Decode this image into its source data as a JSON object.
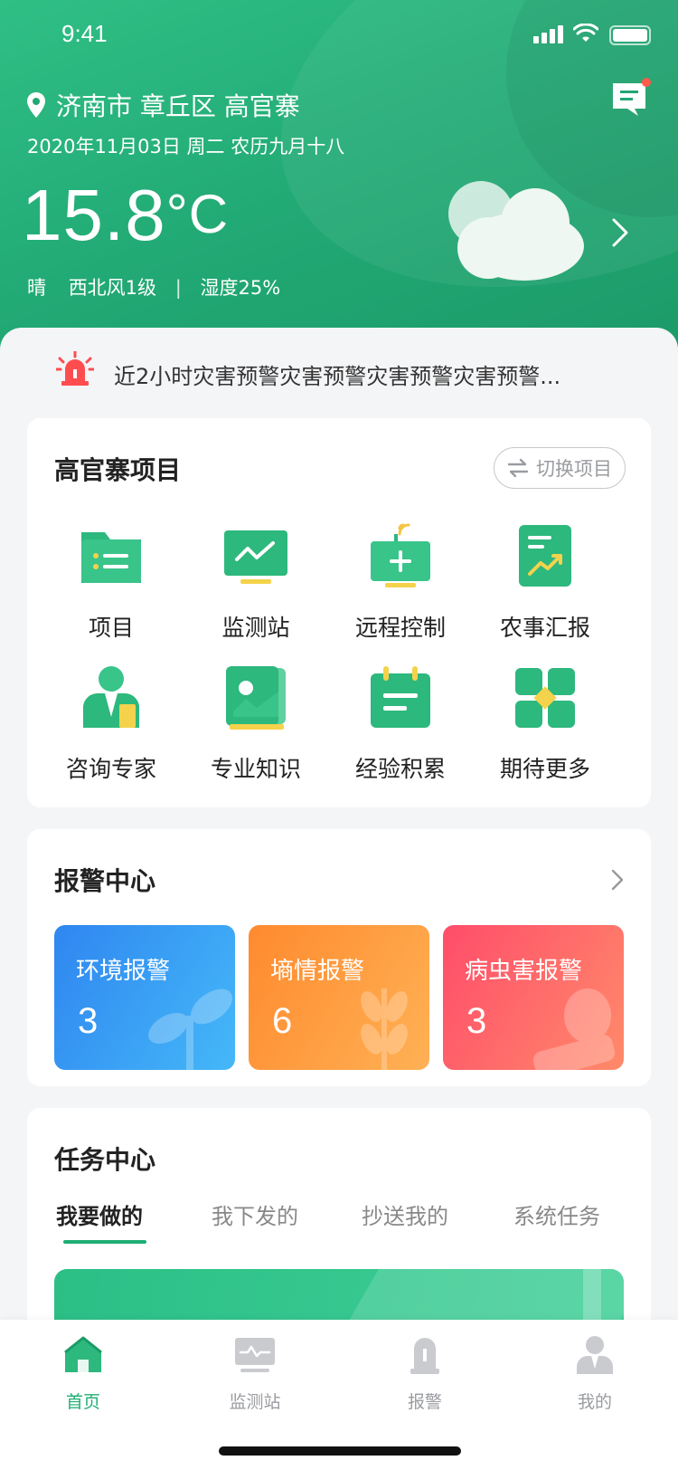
{
  "status": {
    "time": "9:41"
  },
  "header": {
    "location": "济南市 章丘区 高官寨",
    "date": "2020年11月03日 周二 农历九月十八",
    "temp_value": "15.8",
    "temp_unit": "°C",
    "weather": "晴",
    "wind": "西北风1级",
    "separator": "|",
    "humidity": "湿度25%"
  },
  "warning": {
    "text": "近2小时灾害预警灾害预警灾害预警灾害预警..."
  },
  "project": {
    "title": "高官寨项目",
    "switch_label": "切换项目",
    "items": [
      {
        "label": "项目",
        "icon": "folder-icon"
      },
      {
        "label": "监测站",
        "icon": "monitor-icon"
      },
      {
        "label": "远程控制",
        "icon": "remote-control-icon"
      },
      {
        "label": "农事汇报",
        "icon": "report-chart-icon"
      },
      {
        "label": "咨询专家",
        "icon": "expert-icon"
      },
      {
        "label": "专业知识",
        "icon": "book-icon"
      },
      {
        "label": "经验积累",
        "icon": "calendar-notes-icon"
      },
      {
        "label": "期待更多",
        "icon": "grid-more-icon"
      }
    ]
  },
  "alarm": {
    "title": "报警中心",
    "cards": [
      {
        "label": "环境报警",
        "count": "3",
        "color_from": "#2f86f0",
        "color_to": "#45b8f8"
      },
      {
        "label": "墒情报警",
        "count": "6",
        "color_from": "#ff8a2e",
        "color_to": "#ffb155"
      },
      {
        "label": "病虫害报警",
        "count": "3",
        "color_from": "#ff4d6a",
        "color_to": "#ff8a6a"
      }
    ]
  },
  "task": {
    "title": "任务中心",
    "tabs": [
      "我要做的",
      "我下发的",
      "抄送我的",
      "系统任务"
    ],
    "active_tab": 0
  },
  "tabbar": {
    "items": [
      {
        "label": "首页",
        "icon": "home-icon",
        "active": true
      },
      {
        "label": "监测站",
        "icon": "monitor-icon",
        "active": false
      },
      {
        "label": "报警",
        "icon": "alarm-icon",
        "active": false
      },
      {
        "label": "我的",
        "icon": "user-icon",
        "active": false
      }
    ]
  },
  "colors": {
    "brand": "#1fae73",
    "warning_red": "#ff4d4f"
  }
}
